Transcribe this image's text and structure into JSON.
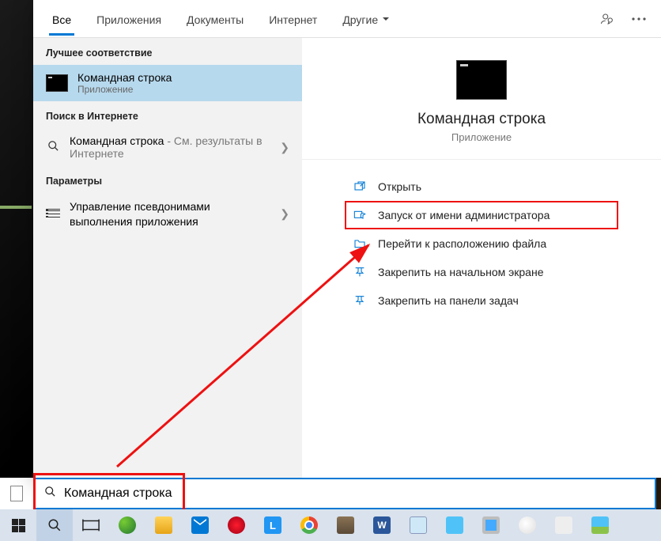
{
  "tabs": {
    "all": "Все",
    "apps": "Приложения",
    "docs": "Документы",
    "internet": "Интернет",
    "more": "Другие"
  },
  "sections": {
    "best": "Лучшее соответствие",
    "web": "Поиск в Интернете",
    "settings": "Параметры"
  },
  "best_match": {
    "title": "Командная строка",
    "subtitle": "Приложение"
  },
  "web_result": {
    "prefix": "Командная строка",
    "suffix": " - См. результаты в Интернете"
  },
  "settings_result": {
    "title": "Управление псевдонимами выполнения приложения"
  },
  "detail": {
    "title": "Командная строка",
    "subtitle": "Приложение"
  },
  "actions": {
    "open": "Открыть",
    "admin": "Запуск от имени администратора",
    "location": "Перейти к расположению файла",
    "pin_start": "Закрепить на начальном экране",
    "pin_task": "Закрепить на панели задач"
  },
  "search_input": "Командная строка"
}
